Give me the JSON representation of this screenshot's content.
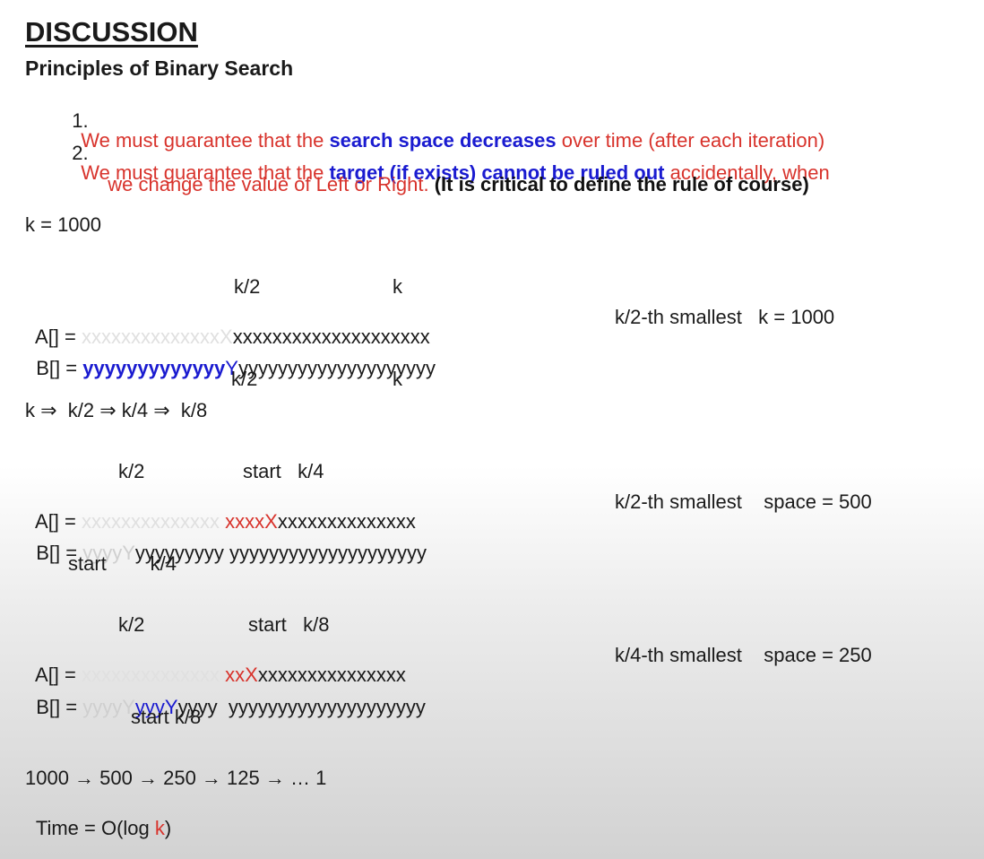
{
  "heading": "DISCUSSION",
  "subheading": "Principles of Binary Search",
  "principles": [
    {
      "number": "1.",
      "part1": "We must guarantee that the ",
      "emphasis": "search space decreases",
      "part2": " over time (after each iteration)"
    },
    {
      "number": "2.",
      "part1": "We must guarantee that the ",
      "emphasis": "target (if exists) cannot be ruled out",
      "part2": " accidentally, when",
      "line2": "we change the value of Left or Right.",
      "note": "(It is critical to define the rule of course)"
    }
  ],
  "k_value": "k = 1000",
  "block1": {
    "top_label_1": "k/2",
    "top_label_2": "k",
    "a_label": "A[] = ",
    "a_faded": "xxxxxxxxxxxxxx",
    "a_mark": "X",
    "a_rest": "xxxxxxxxxxxxxxxxxxxx",
    "b_label": "B[] = ",
    "b_highlight": "yyyyyyyyyyyyy",
    "b_mark": "Y",
    "b_rest": "yyyyyyyyyyyyyyyyyyyy",
    "bottom_label_1": "k/2",
    "bottom_label_2": "k",
    "note": "k/2-th smallest   k = 1000",
    "reduction": "k ⇒  k/2 ⇒ k/4 ⇒  k/8"
  },
  "block2": {
    "top_label_1": "k/2",
    "top_label_2": "start   k/4",
    "a_label": "A[] = ",
    "a_faded": "xxxxxxxxxxxxxx ",
    "a_red": "xxxxX",
    "a_rest": "xxxxxxxxxxxxxx",
    "b_label": "B[] = ",
    "b_faded": "yyyyY",
    "b_rest1": "yyyyyyyyy ",
    "b_rest2": "yyyyyyyyyyyyyyyyyyyy",
    "bottom_label": "start        k/4",
    "note": "k/2-th smallest    space = 500"
  },
  "block3": {
    "top_label_1": "k/2",
    "top_label_2": "start   k/8",
    "a_label": "A[] = ",
    "a_faded": "xxxxxxxxxxxxxx ",
    "a_red": "xxX",
    "a_rest": "xxxxxxxxxxxxxxx",
    "b_label": "B[] = ",
    "b_faded": "yyyyY",
    "b_blue": "yyyY",
    "b_rest1": "yyyy  ",
    "b_rest2": "yyyyyyyyyyyyyyyyyyyy",
    "bottom_label": "start k/8",
    "note": "k/4-th smallest    space = 250"
  },
  "sequence": "1000 → 500 → 250 → 125 → … 1",
  "time_prefix": "Time = O(log ",
  "time_var": "k",
  "time_suffix": ")"
}
